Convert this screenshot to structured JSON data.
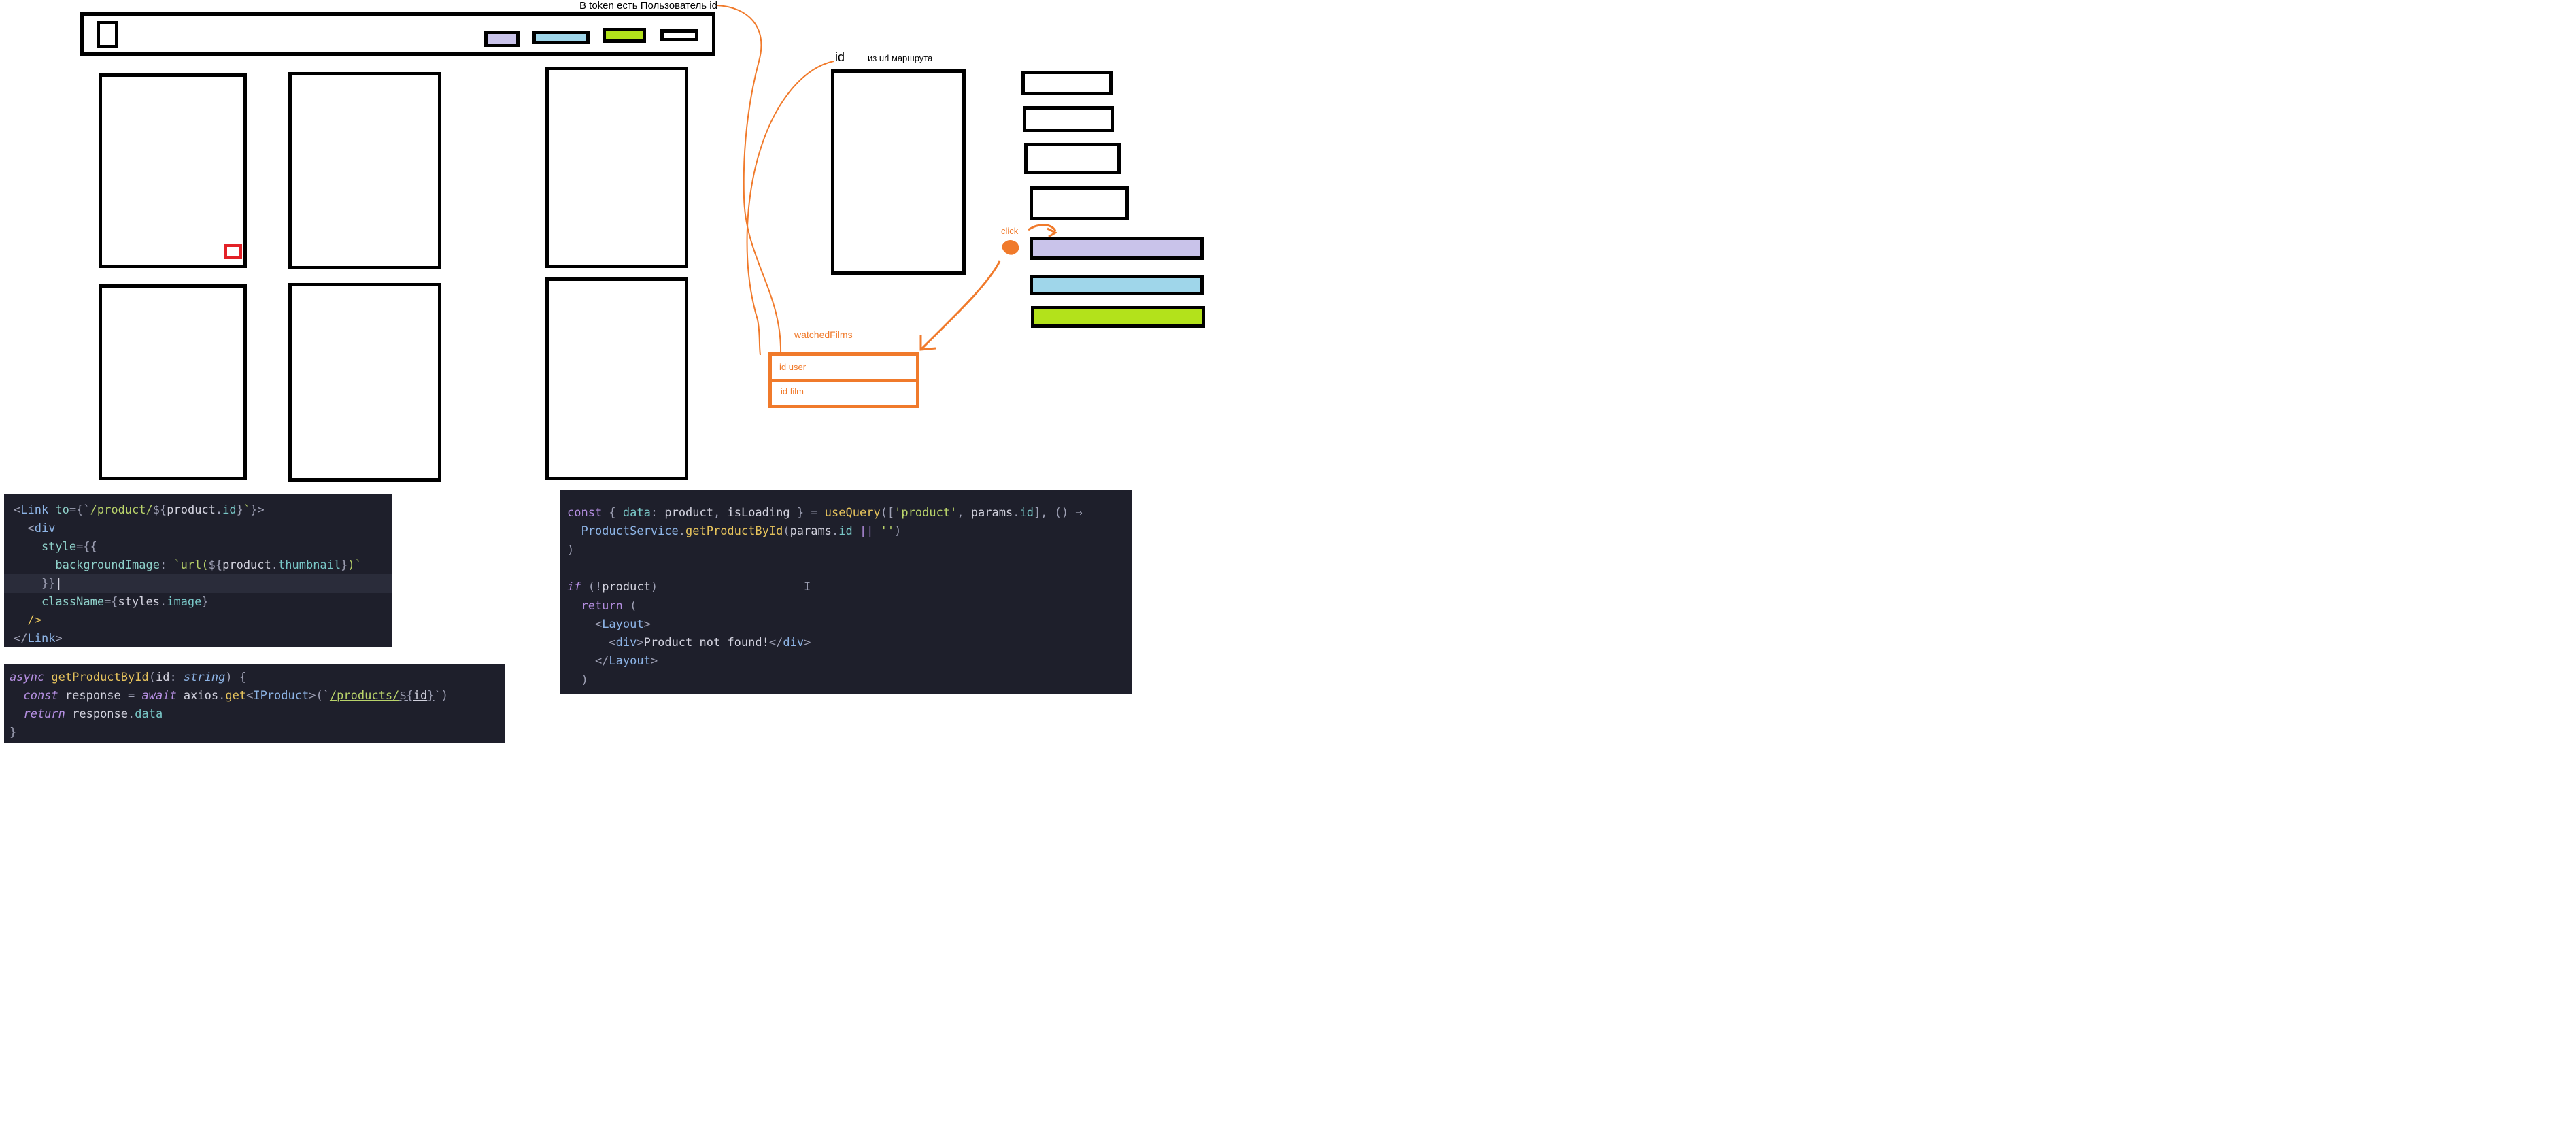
{
  "header": {
    "swatch_colors": [
      "#c9c3ea",
      "#9fd6ea",
      "#b3e21b",
      "#ffffff"
    ]
  },
  "annotations": {
    "token_note": "В token есть Пользователь id",
    "id_label": "id",
    "url_note": "из url маршрута",
    "click_label": "click",
    "table_title": "watchedFilms",
    "row_user": "id user",
    "row_film": "id film"
  },
  "side_buttons": {
    "colors": [
      "#c9c3ea",
      "#9fd6ea",
      "#b3e21b"
    ]
  },
  "code_link": {
    "lines": [
      [
        [
          "<",
          "tok-pun"
        ],
        [
          "Link",
          "tok-tag"
        ],
        [
          " to",
          "tok-attr"
        ],
        [
          "={`",
          "tok-pun"
        ],
        [
          "/product/",
          "tok-str"
        ],
        [
          "${",
          "tok-pun"
        ],
        [
          "product",
          "tok-var"
        ],
        [
          ".",
          "tok-pun"
        ],
        [
          "id",
          "tok-prop"
        ],
        [
          "}",
          "tok-pun"
        ],
        [
          "`",
          "tok-str"
        ],
        [
          "}>",
          "tok-pun"
        ]
      ],
      [
        [
          "  <",
          "tok-pun"
        ],
        [
          "div",
          "tok-tag"
        ]
      ],
      [
        [
          "    style",
          "tok-attr"
        ],
        [
          "={{",
          "tok-pun"
        ]
      ],
      [
        [
          "    ",
          "tok-pun"
        ],
        [
          "  backgroundImage",
          "tok-attr"
        ],
        [
          ": ",
          "tok-pun"
        ],
        [
          "`url(",
          "tok-str"
        ],
        [
          "${",
          "tok-pun"
        ],
        [
          "product",
          "tok-var"
        ],
        [
          ".",
          "tok-pun"
        ],
        [
          "thumbnail",
          "tok-prop"
        ],
        [
          "}",
          "tok-pun"
        ],
        [
          ")`",
          "tok-str"
        ]
      ],
      [
        [
          "    }}",
          "tok-pun"
        ],
        [
          "|",
          "tok-var"
        ]
      ],
      [
        [
          "    className",
          "tok-attr"
        ],
        [
          "={",
          "tok-pun"
        ],
        [
          "styles",
          "tok-var"
        ],
        [
          ".",
          "tok-pun"
        ],
        [
          "image",
          "tok-prop"
        ],
        [
          "}",
          "tok-pun"
        ]
      ],
      [
        [
          "  />",
          "tok-fn"
        ]
      ],
      [
        [
          "</",
          "tok-pun"
        ],
        [
          "Link",
          "tok-tag"
        ],
        [
          ">",
          "tok-pun"
        ]
      ]
    ]
  },
  "code_service": {
    "lines": [
      [
        [
          "async ",
          "tok-kw tok-it"
        ],
        [
          "getProductById",
          "tok-fn"
        ],
        [
          "(",
          "tok-pun"
        ],
        [
          "id",
          "tok-var"
        ],
        [
          ": ",
          "tok-pun"
        ],
        [
          "string",
          "tok-type tok-it"
        ],
        [
          ") {",
          "tok-pun"
        ]
      ],
      [
        [
          "  const ",
          "tok-kw tok-it"
        ],
        [
          "response",
          "tok-var"
        ],
        [
          " = ",
          "tok-pun"
        ],
        [
          "await ",
          "tok-kw tok-it"
        ],
        [
          "axios",
          "tok-var"
        ],
        [
          ".",
          "tok-pun"
        ],
        [
          "get",
          "tok-fn"
        ],
        [
          "<",
          "tok-pun"
        ],
        [
          "IProduct",
          "tok-type"
        ],
        [
          ">(`",
          "tok-pun"
        ],
        [
          "/products/",
          "tok-str tok-u"
        ],
        [
          "${",
          "tok-pun tok-u"
        ],
        [
          "id",
          "tok-var tok-u"
        ],
        [
          "}",
          "tok-pun tok-u"
        ],
        [
          "`)",
          "tok-pun"
        ]
      ],
      [
        [
          "  return ",
          "tok-kw tok-it"
        ],
        [
          "response",
          "tok-var"
        ],
        [
          ".",
          "tok-pun"
        ],
        [
          "data",
          "tok-prop"
        ]
      ],
      [
        [
          "}",
          "tok-pun"
        ]
      ]
    ]
  },
  "code_query": {
    "lines": [
      [
        [
          "const ",
          "tok-kw"
        ],
        [
          "{ ",
          "tok-pun"
        ],
        [
          "data",
          "tok-prop"
        ],
        [
          ": ",
          "tok-pun"
        ],
        [
          "product",
          "tok-var"
        ],
        [
          ", ",
          "tok-pun"
        ],
        [
          "isLoading",
          "tok-var"
        ],
        [
          " } = ",
          "tok-pun"
        ],
        [
          "useQuery",
          "tok-fn"
        ],
        [
          "([",
          "tok-pun"
        ],
        [
          "'product'",
          "tok-str"
        ],
        [
          ", ",
          "tok-pun"
        ],
        [
          "params",
          "tok-var"
        ],
        [
          ".",
          "tok-pun"
        ],
        [
          "id",
          "tok-prop"
        ],
        [
          "], () ⇒",
          "tok-pun"
        ]
      ],
      [
        [
          "  ProductService",
          "tok-tag"
        ],
        [
          ".",
          "tok-pun"
        ],
        [
          "getProductById",
          "tok-fn"
        ],
        [
          "(",
          "tok-pun"
        ],
        [
          "params",
          "tok-var"
        ],
        [
          ".",
          "tok-pun"
        ],
        [
          "id",
          "tok-prop"
        ],
        [
          " || ",
          "tok-kw"
        ],
        [
          "''",
          "tok-str"
        ],
        [
          ")",
          "tok-pun"
        ]
      ],
      [
        [
          ")",
          "tok-pun"
        ]
      ],
      [
        [
          "",
          "tok-pun"
        ]
      ],
      [
        [
          "if ",
          "tok-kw tok-it"
        ],
        [
          "(!",
          "tok-pun"
        ],
        [
          "product",
          "tok-var"
        ],
        [
          ")",
          "tok-pun"
        ],
        [
          "                     I",
          "tok-pun"
        ]
      ],
      [
        [
          "  return ",
          "tok-kw"
        ],
        [
          "(",
          "tok-pun"
        ]
      ],
      [
        [
          "    <",
          "tok-pun"
        ],
        [
          "Layout",
          "tok-tag"
        ],
        [
          ">",
          "tok-pun"
        ]
      ],
      [
        [
          "      <",
          "tok-pun"
        ],
        [
          "div",
          "tok-tag"
        ],
        [
          ">",
          "tok-pun"
        ],
        [
          "Product not found!",
          "tok-var"
        ],
        [
          "</",
          "tok-pun"
        ],
        [
          "div",
          "tok-tag"
        ],
        [
          ">",
          "tok-pun"
        ]
      ],
      [
        [
          "    </",
          "tok-pun"
        ],
        [
          "Layout",
          "tok-tag"
        ],
        [
          ">",
          "tok-pun"
        ]
      ],
      [
        [
          "  )",
          "tok-pun"
        ]
      ]
    ]
  }
}
